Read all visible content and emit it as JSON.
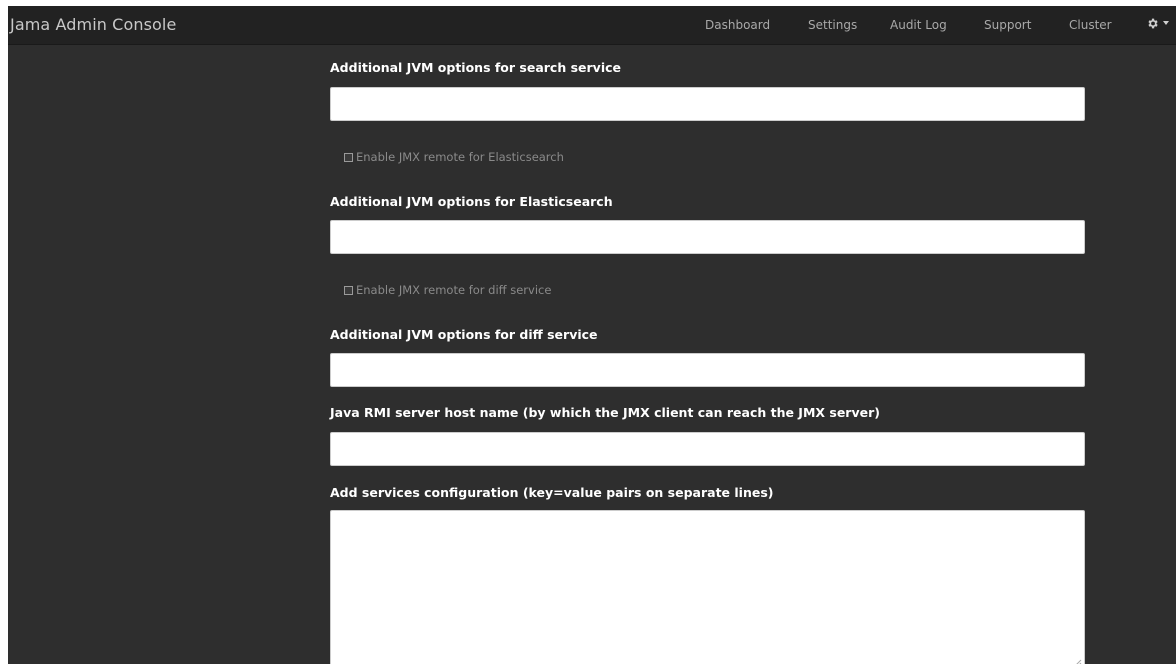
{
  "app": {
    "title": "Jama Admin Console"
  },
  "nav": {
    "items": [
      {
        "label": "Dashboard"
      },
      {
        "label": "Settings"
      },
      {
        "label": "Audit Log"
      },
      {
        "label": "Support"
      },
      {
        "label": "Cluster"
      }
    ],
    "settings_icon": "gear-icon"
  },
  "form": {
    "search_jvm": {
      "label": "Additional JVM options for search service",
      "value": ""
    },
    "jmx_elasticsearch": {
      "label": "Enable JMX remote for Elasticsearch",
      "checked": false
    },
    "elasticsearch_jvm": {
      "label": "Additional JVM options for Elasticsearch",
      "value": ""
    },
    "jmx_diff": {
      "label": "Enable JMX remote for diff service",
      "checked": false
    },
    "diff_jvm": {
      "label": "Additional JVM options for diff service",
      "value": ""
    },
    "rmi_host": {
      "label": "Java RMI server host name (by which the JMX client can reach the JMX server)",
      "value": ""
    },
    "services_config": {
      "label": "Add services configuration (key=value pairs on separate lines)",
      "value": ""
    }
  },
  "colors": {
    "navbar": "#222222",
    "background": "#2e2e2e",
    "label_text": "#ffffff",
    "muted_text": "#8a8a8a"
  }
}
